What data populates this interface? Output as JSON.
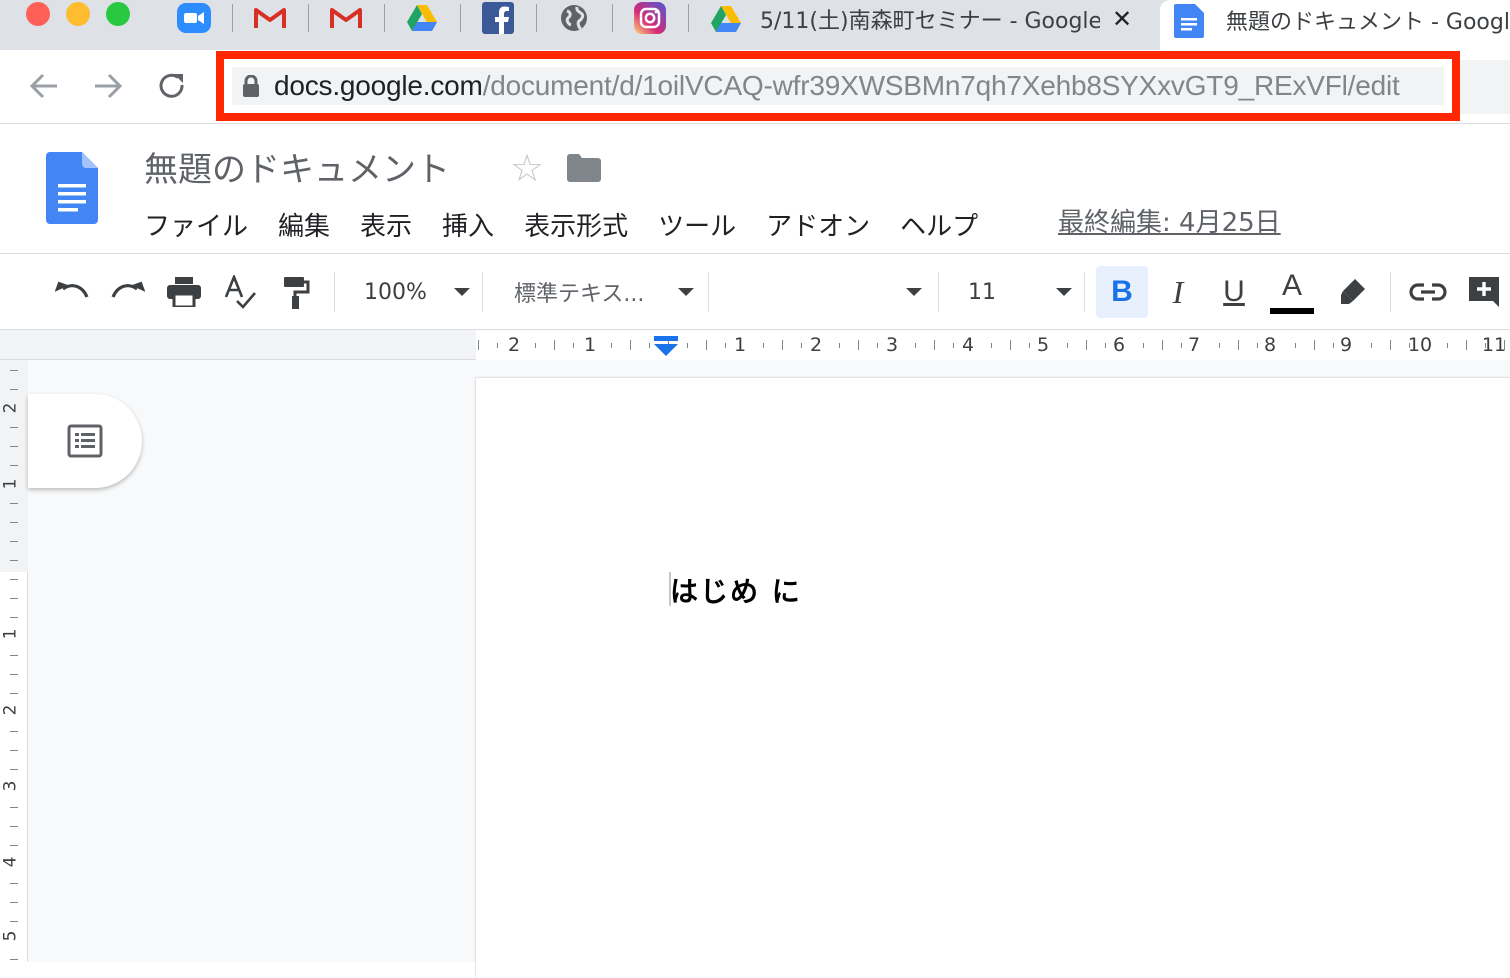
{
  "browser": {
    "pinned_tabs": [
      {
        "icon": "zoom-icon"
      },
      {
        "icon": "gmail-icon"
      },
      {
        "icon": "gmail-icon"
      },
      {
        "icon": "google-drive-icon"
      },
      {
        "icon": "facebook-icon"
      },
      {
        "icon": "globe-icon"
      },
      {
        "icon": "instagram-icon"
      }
    ],
    "tabs": [
      {
        "title": "5/11(土)南森町セミナー - Google",
        "icon": "google-drive-icon",
        "close": "✕"
      },
      {
        "title": "無題のドキュメント - Googl",
        "icon": "google-docs-icon"
      }
    ],
    "url_host": "docs.google.com",
    "url_path": "/document/d/1oilVCAQ-wfr39XWSBMn7qh7Xehb8SYXxvGT9_RExVFl/edit",
    "highlight_color": "#ff2600"
  },
  "docs": {
    "title": "無題のドキュメント",
    "menu": [
      "ファイル",
      "編集",
      "表示",
      "挿入",
      "表示形式",
      "ツール",
      "アドオン",
      "ヘルプ"
    ],
    "last_edit": "最終編集: 4月25日",
    "toolbar": {
      "zoom": "100%",
      "style": "標準テキス...",
      "font": "",
      "font_size": "11",
      "bold": "B",
      "italic": "I",
      "underline": "U",
      "text_color": "A",
      "accent_color": "#1a73e8"
    },
    "ruler": {
      "h_labels": [
        "2",
        "1",
        "1",
        "2",
        "3",
        "4",
        "5",
        "6",
        "7",
        "8",
        "9",
        "10",
        "11"
      ],
      "v_labels": [
        "2",
        "1",
        "1",
        "2",
        "3",
        "4",
        "5"
      ]
    },
    "body_text": "はじめ に"
  }
}
